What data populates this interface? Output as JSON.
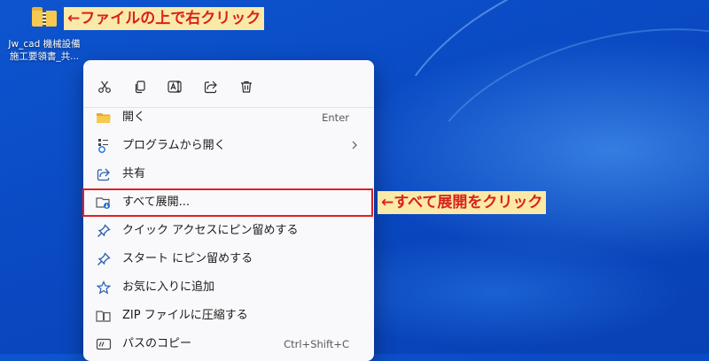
{
  "desktop_icon": {
    "line1": "Jw_cad 機械設備",
    "line2": "施工要領書_共..."
  },
  "callouts": {
    "top": "←ファイルの上で右クリック",
    "middle": "←すべて展開をクリック"
  },
  "colors": {
    "callout_bg": "#fbe9a8",
    "callout_text": "#d6221c",
    "highlight_border": "#e01f25",
    "desktop_blue": "#0a49c2"
  },
  "toolbar": {
    "icons": [
      "cut-icon",
      "copy-icon",
      "rename-icon",
      "share-icon",
      "delete-icon"
    ]
  },
  "menu": {
    "items": [
      {
        "label": "開く",
        "accelerator": "Enter",
        "icon": "folder-open-icon"
      },
      {
        "label": "プログラムから開く",
        "accelerator": "",
        "icon": "open-with-icon",
        "submenu": true
      },
      {
        "label": "共有",
        "accelerator": "",
        "icon": "share-icon"
      },
      {
        "label": "すべて展開...",
        "accelerator": "",
        "icon": "extract-all-icon",
        "highlighted": true
      },
      {
        "label": "クイック アクセスにピン留めする",
        "accelerator": "",
        "icon": "pin-icon"
      },
      {
        "label": "スタート にピン留めする",
        "accelerator": "",
        "icon": "pin-icon"
      },
      {
        "label": "お気に入りに追加",
        "accelerator": "",
        "icon": "star-icon"
      },
      {
        "label": "ZIP ファイルに圧縮する",
        "accelerator": "",
        "icon": "zip-icon"
      },
      {
        "label": "パスのコピー",
        "accelerator": "Ctrl+Shift+C",
        "icon": "copy-path-icon"
      }
    ]
  }
}
